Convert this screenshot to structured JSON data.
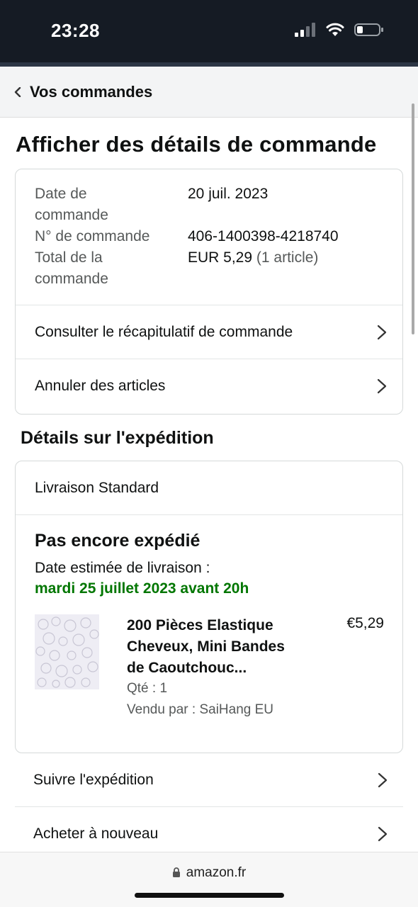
{
  "status_bar": {
    "time": "23:28"
  },
  "nav": {
    "back_label": "Vos commandes"
  },
  "page": {
    "title": "Afficher des détails de commande"
  },
  "order_info": {
    "date_label_l1": "Date de",
    "date_label_l2": "commande",
    "date_value": "20 juil. 2023",
    "number_label": "N° de commande",
    "number_value": "406-1400398-4218740",
    "total_label_l1": "Total de la",
    "total_label_l2": "commande",
    "total_amount": "EUR 5,29",
    "total_items": "(1 article)"
  },
  "order_actions": {
    "summary_label": "Consulter le récapitulatif de commande",
    "cancel_label": "Annuler des articles"
  },
  "shipment": {
    "section_title": "Détails sur l'expédition",
    "method": "Livraison Standard",
    "status": "Pas encore expédié",
    "eta_label": "Date estimée de livraison :",
    "eta_date": "mardi 25 juillet 2023 avant 20h",
    "product": {
      "title_l1": "200 Pièces Elastique",
      "title_l2": "Cheveux, Mini Bandes",
      "title_l3": "de Caoutchouc...",
      "price": "€5,29",
      "quantity": "Qté : 1",
      "seller": "Vendu par : SaiHang EU"
    }
  },
  "actions": {
    "track_label": "Suivre l'expédition",
    "buy_again_label": "Acheter à nouveau"
  },
  "browser": {
    "url": "amazon.fr"
  }
}
